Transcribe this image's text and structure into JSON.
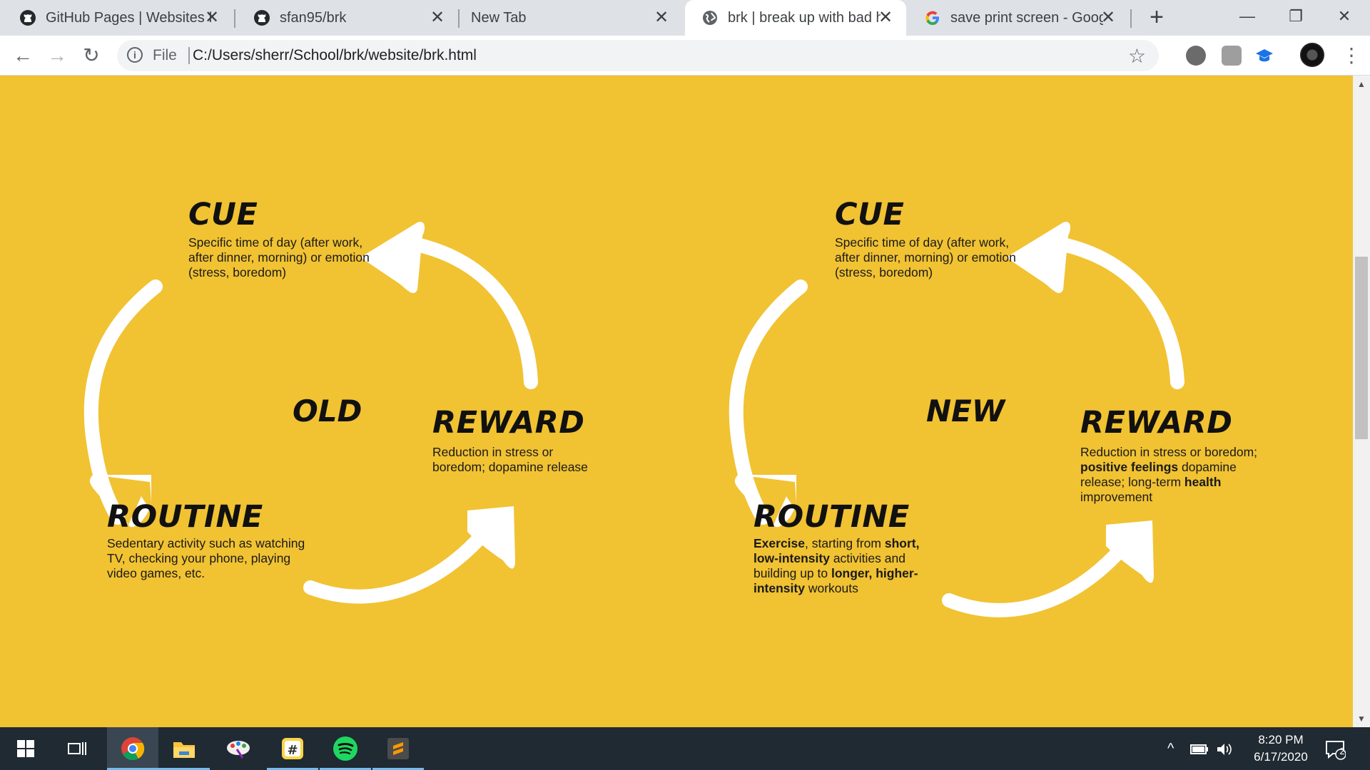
{
  "browser": {
    "tabs": [
      {
        "title": "GitHub Pages | Websites for",
        "icon": "github-icon"
      },
      {
        "title": "sfan95/brk",
        "icon": "github-icon"
      },
      {
        "title": "New Tab",
        "icon": ""
      },
      {
        "title": "brk | break up with bad hab",
        "icon": "globe-icon",
        "active": true
      },
      {
        "title": "save print screen - Google",
        "icon": "google-icon"
      }
    ],
    "new_tab_label": "+",
    "window_controls": {
      "minimize": "—",
      "restore": "❐",
      "close": "✕"
    },
    "toolbar": {
      "back": "←",
      "forward": "→",
      "reload": "↻",
      "scheme": "File",
      "url": "C:/Users/sherr/School/brk/website/brk.html",
      "bookmark": "☆",
      "menu": "⋮"
    }
  },
  "page": {
    "background": "#f1c232",
    "arrow_color": "#ffffff",
    "old_loop": {
      "center": "OLD",
      "cue": {
        "title": "CUE",
        "text": "Specific time of day (after work, after dinner, morning) or emotion (stress, boredom)"
      },
      "reward": {
        "title": "REWARD",
        "text": "Reduction in stress or boredom; dopamine release"
      },
      "routine": {
        "title": "ROUTINE",
        "text": "Sedentary activity such as watching TV, checking your phone, playing video games, etc."
      }
    },
    "new_loop": {
      "center": "NEW",
      "cue": {
        "title": "CUE",
        "text": "Specific time of day (after work, after dinner, morning) or emotion (stress, boredom)"
      },
      "reward": {
        "title": "REWARD",
        "t1": "Reduction in stress or boredom; ",
        "b1": "positive feelings",
        "t2": " dopamine release; long-term ",
        "b2": "health",
        "t3": " improvement"
      },
      "routine": {
        "title": "ROUTINE",
        "b1": "Exercise",
        "t1": ", starting from ",
        "b2": "short, low-intensity",
        "t2": " activities and building up to ",
        "b3": "longer, higher-intensity",
        "t3": " workouts"
      }
    }
  },
  "taskbar": {
    "apps": [
      "windows-start-icon",
      "task-view-icon",
      "chrome-icon",
      "file-explorer-icon",
      "paint-icon",
      "slack-icon",
      "spotify-icon",
      "sublime-text-icon"
    ],
    "clock_time": "8:20 PM",
    "clock_date": "6/17/2020",
    "notification_count": "2"
  }
}
